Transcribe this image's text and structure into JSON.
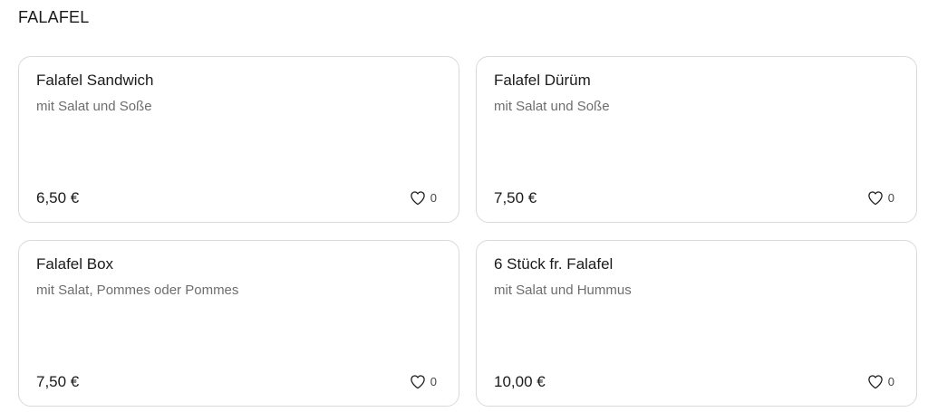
{
  "section": {
    "title": "FALAFEL"
  },
  "items": [
    {
      "name": "Falafel Sandwich",
      "description": "mit Salat und Soße",
      "price": "6,50 €",
      "favorite_icon": "heart-outline-icon",
      "favorites": "0"
    },
    {
      "name": "Falafel Dürüm",
      "description": "mit Salat und Soße",
      "price": "7,50 €",
      "favorite_icon": "heart-outline-icon",
      "favorites": "0"
    },
    {
      "name": "Falafel Box",
      "description": "mit Salat, Pommes oder Pommes",
      "price": "7,50 €",
      "favorite_icon": "heart-outline-icon",
      "favorites": "0"
    },
    {
      "name": "6 Stück fr. Falafel",
      "description": "mit Salat und Hummus",
      "price": "10,00 €",
      "favorite_icon": "heart-outline-icon",
      "favorites": "0"
    }
  ],
  "colors": {
    "card_border": "#d9d9d9",
    "text_primary": "#1a1a1a",
    "text_secondary": "#6e6e6e"
  }
}
